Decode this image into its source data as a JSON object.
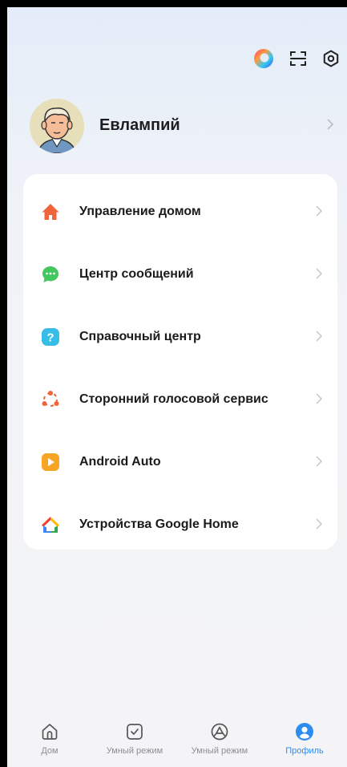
{
  "user": {
    "name": "Евлампий"
  },
  "header_icons": [
    "assistant-logo-icon",
    "scan-icon",
    "settings-icon"
  ],
  "menu": [
    {
      "label": "Управление домом",
      "icon": "home-icon",
      "color": "#f0643c"
    },
    {
      "label": "Центр сообщений",
      "icon": "message-icon",
      "color": "#43c75e"
    },
    {
      "label": "Справочный центр",
      "icon": "help-icon",
      "color": "#38bde8"
    },
    {
      "label": "Сторонний голосовой сервис",
      "icon": "voice-service-icon",
      "color": "#f0643c"
    },
    {
      "label": "Android Auto",
      "icon": "android-auto-icon",
      "color": "#f6a623"
    },
    {
      "label": "Устройства Google Home",
      "icon": "google-home-icon",
      "color": "#4285f4"
    }
  ],
  "tabs": [
    {
      "label": "Дом",
      "icon": "home-outline-icon",
      "active": false
    },
    {
      "label": "Умный режим",
      "icon": "checkbox-icon",
      "active": false
    },
    {
      "label": "Умный режим",
      "icon": "automation-icon",
      "active": false
    },
    {
      "label": "Профиль",
      "icon": "profile-icon",
      "active": true
    }
  ],
  "colors": {
    "accent": "#2d8cf0",
    "inactive_tab": "#8a8f97"
  }
}
